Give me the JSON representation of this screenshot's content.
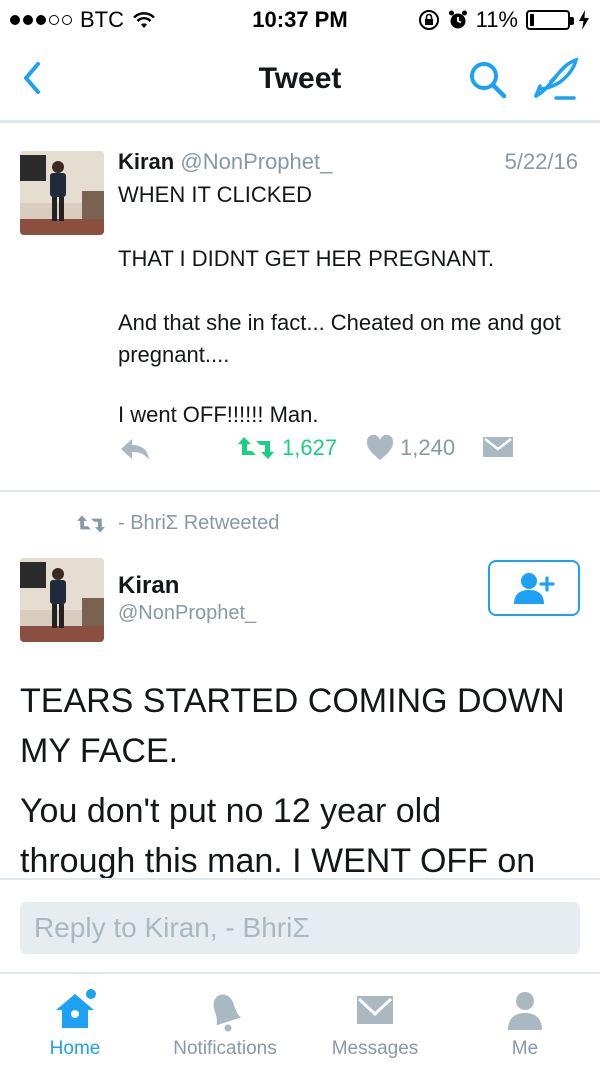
{
  "status_bar": {
    "carrier": "BTC",
    "time": "10:37 PM",
    "battery": "11%",
    "battery_level": 0.11,
    "signal_dots_filled": 3,
    "signal_dots_total": 5
  },
  "nav": {
    "title": "Tweet",
    "back_icon": "chevron-left-icon",
    "search_icon": "search-icon",
    "compose_icon": "compose-icon"
  },
  "tweet1": {
    "name": "Kiran",
    "handle": "@NonProphet_",
    "date": "5/22/16",
    "paragraphs": [
      "WHEN IT CLICKED",
      "THAT I DIDNT GET HER PREGNANT.",
      "And that she in fact... Cheated on me and got pregnant....",
      "I went OFF!!!!!! Man."
    ],
    "retweets": "1,627",
    "likes": "1,240"
  },
  "retweeted_by": {
    "text": "- BhriΣ Retweeted"
  },
  "main_tweet": {
    "name": "Kiran",
    "handle": "@NonProphet_",
    "line1": "TEARS STARTED COMING DOWN",
    "line2": "MY FACE.",
    "line3": "You don't put no 12 year old",
    "line4": "through this man. I WENT OFF on"
  },
  "reply": {
    "placeholder": "Reply to Kiran, - BhriΣ"
  },
  "tabs": [
    {
      "label": "Home",
      "icon": "home-icon",
      "active": true
    },
    {
      "label": "Notifications",
      "icon": "bell-icon",
      "active": false
    },
    {
      "label": "Messages",
      "icon": "envelope-icon",
      "active": false
    },
    {
      "label": "Me",
      "icon": "person-icon",
      "active": false
    }
  ],
  "colors": {
    "accent": "#1da1f2",
    "retweet_green": "#19cf86",
    "secondary_text": "#8899a6",
    "divider": "#e1e8ed"
  }
}
